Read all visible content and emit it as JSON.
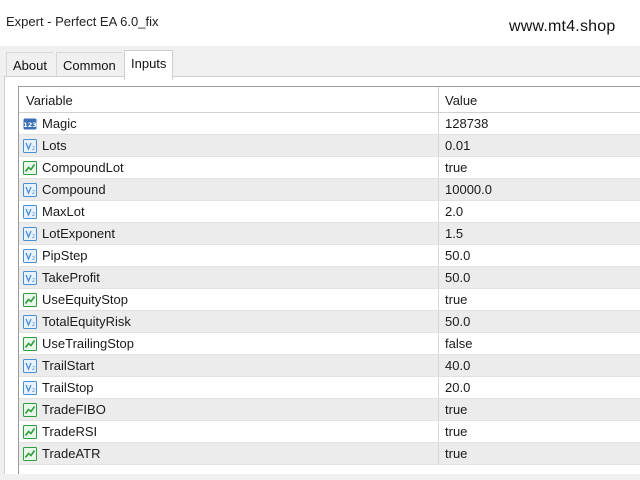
{
  "window": {
    "title": "Expert - Perfect EA 6.0_fix",
    "watermark": "www.mt4.shop"
  },
  "tabs": [
    {
      "label": "About",
      "active": false
    },
    {
      "label": "Common",
      "active": false
    },
    {
      "label": "Inputs",
      "active": true
    }
  ],
  "table": {
    "columns": {
      "variable": "Variable",
      "value": "Value"
    },
    "rows": [
      {
        "name": "Magic",
        "value": "128738",
        "icon": "integer-icon"
      },
      {
        "name": "Lots",
        "value": "0.01",
        "icon": "double-icon"
      },
      {
        "name": "CompoundLot",
        "value": "true",
        "icon": "bool-icon"
      },
      {
        "name": "Compound",
        "value": "10000.0",
        "icon": "double-icon"
      },
      {
        "name": "MaxLot",
        "value": "2.0",
        "icon": "double-icon"
      },
      {
        "name": "LotExponent",
        "value": "1.5",
        "icon": "double-icon"
      },
      {
        "name": "PipStep",
        "value": "50.0",
        "icon": "double-icon"
      },
      {
        "name": "TakeProfit",
        "value": "50.0",
        "icon": "double-icon"
      },
      {
        "name": "UseEquityStop",
        "value": "true",
        "icon": "bool-icon"
      },
      {
        "name": "TotalEquityRisk",
        "value": "50.0",
        "icon": "double-icon"
      },
      {
        "name": "UseTrailingStop",
        "value": "false",
        "icon": "bool-icon"
      },
      {
        "name": "TrailStart",
        "value": "40.0",
        "icon": "double-icon"
      },
      {
        "name": "TrailStop",
        "value": "20.0",
        "icon": "double-icon"
      },
      {
        "name": "TradeFIBO",
        "value": "true",
        "icon": "bool-icon"
      },
      {
        "name": "TradeRSI",
        "value": "true",
        "icon": "bool-icon"
      },
      {
        "name": "TradeATR",
        "value": "true",
        "icon": "bool-icon"
      }
    ]
  },
  "colors": {
    "int_icon": "#3b6fb6",
    "double_icon": "#4a90d9",
    "bool_icon": "#2e9e3e"
  }
}
